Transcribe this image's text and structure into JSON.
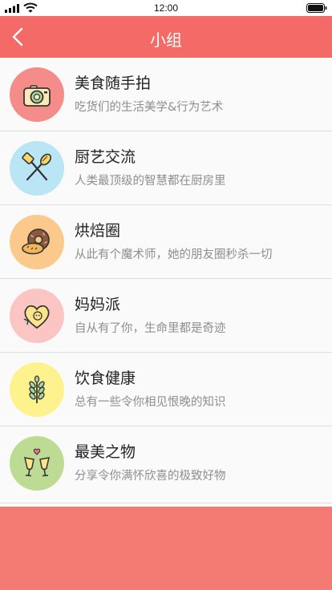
{
  "status_bar": {
    "time": "12:00"
  },
  "nav": {
    "title": "小组",
    "back_icon": "chevron-left-icon"
  },
  "colors": {
    "nav_background": "#f46a67",
    "footer_background": "#f47a74",
    "list_background": "#fafafa"
  },
  "groups": [
    {
      "name": "美食随手拍",
      "desc": "吃货们的生活美学&行为艺术",
      "icon": "camera-icon",
      "color": "#f48d8a"
    },
    {
      "name": "厨艺交流",
      "desc": "人类最顶级的智慧都在厨房里",
      "icon": "spatula-whisk-icon",
      "color": "#b9e5f5"
    },
    {
      "name": "烘焙圈",
      "desc": "从此有个魔术师，她的朋友圈秒杀一切",
      "icon": "donut-bread-icon",
      "color": "#fbc98b"
    },
    {
      "name": "妈妈派",
      "desc": "自从有了你，生命里都是奇迹",
      "icon": "heart-baby-icon",
      "color": "#fbc5c4"
    },
    {
      "name": "饮食健康",
      "desc": "总有一些令你相见恨晚的知识",
      "icon": "wheat-icon",
      "color": "#fdf28e"
    },
    {
      "name": "最美之物",
      "desc": "分享令你满怀欣喜的极致好物",
      "icon": "cheers-glasses-icon",
      "color": "#bedb93"
    }
  ]
}
